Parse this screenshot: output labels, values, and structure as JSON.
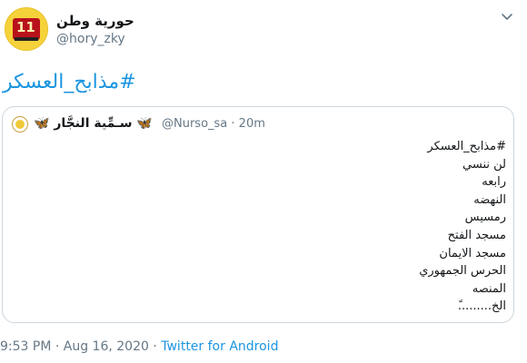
{
  "user": {
    "name": "حورية وطن",
    "handle": "@hory_zky",
    "avatar_text": "11"
  },
  "tweet": {
    "hashtag": "#مذابح_العسكر"
  },
  "quoted": {
    "name": "سـمِّية النجَّار",
    "name_emoji": "🦋",
    "handle_time": "@Nurso_sa · 20m",
    "lines": [
      "#مذابح_العسكر",
      "لن ننسي",
      "رابعه",
      "النهضه",
      "رمسيس",
      "مسجد الفتح",
      "مسجد الايمان",
      "الحرس الجمهوري",
      "المنصه",
      "الخ.........ً"
    ]
  },
  "footer": {
    "timestamp": "9:53 PM · Aug 16, 2020 · ",
    "source": "Twitter for Android"
  },
  "colors": {
    "link": "#1b95e0",
    "secondary": "#657786",
    "border": "#ccd6dd"
  },
  "icons": {
    "menu": "chevron-down-icon"
  }
}
